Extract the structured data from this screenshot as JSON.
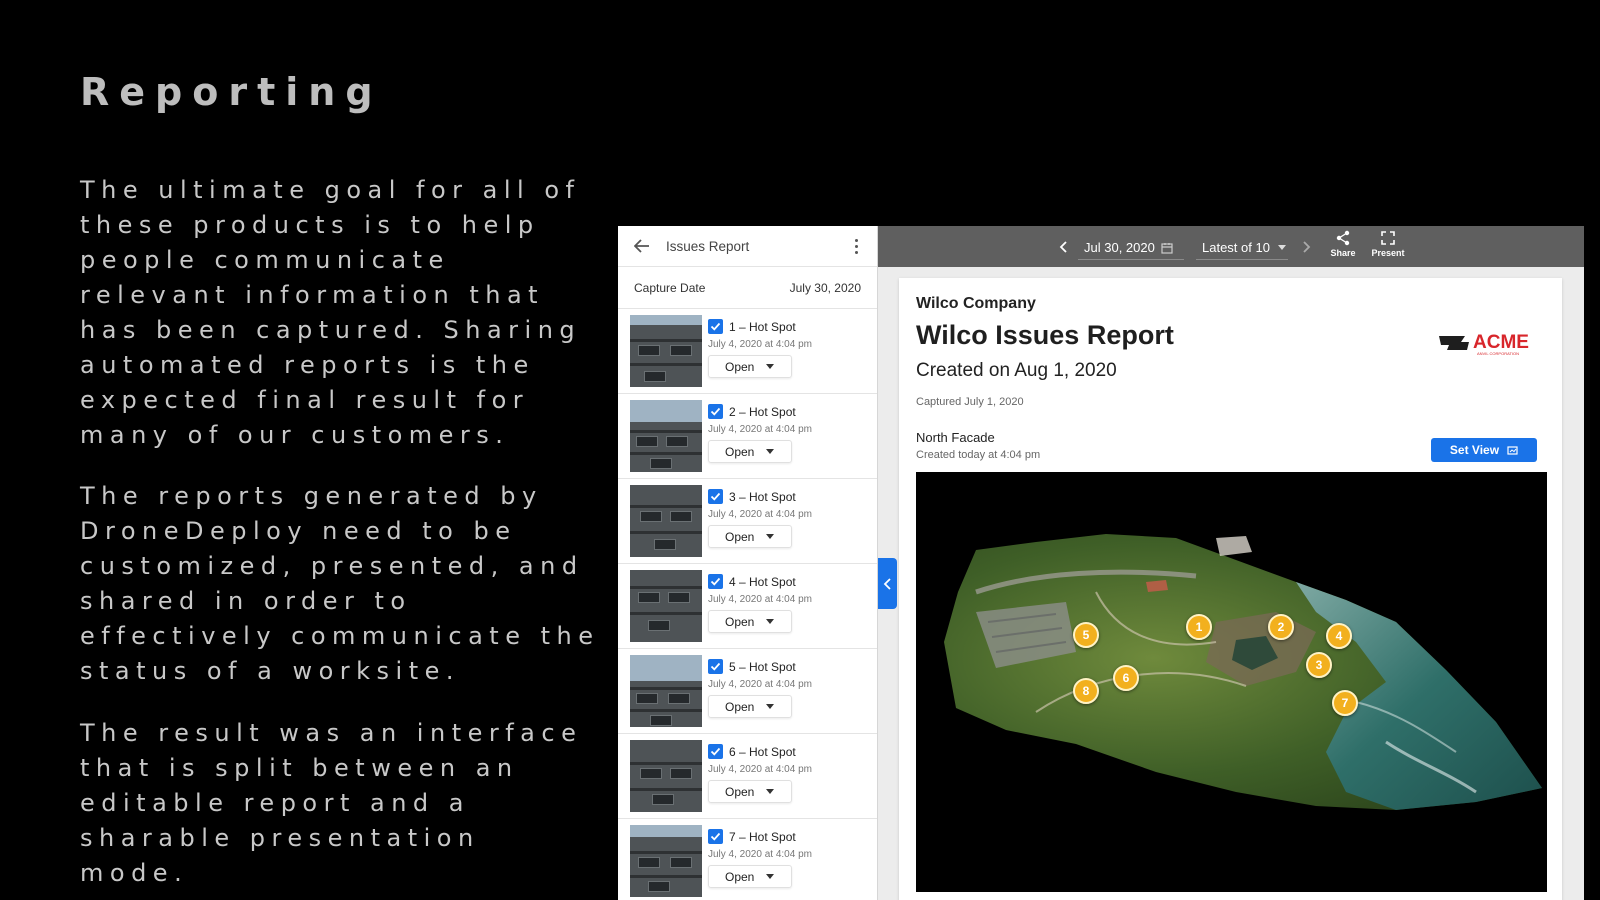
{
  "slide": {
    "title": "Reporting",
    "paragraphs": [
      "The ultimate goal for all of these products is to help people communicate relevant information that has been captured. Sharing automated reports is the expected final result for many of our customers.",
      "The reports generated by DroneDeploy need to be customized, presented, and shared in order to effectively communicate the status of a worksite.",
      "The result was an interface that is split between an editable report and a sharable presentation mode."
    ]
  },
  "sidebar": {
    "title": "Issues Report",
    "capture_label": "Capture Date",
    "capture_value": "July 30, 2020",
    "issues": [
      {
        "name": "1 – Hot Spot",
        "date": "July 4, 2020 at 4:04 pm",
        "status": "Open"
      },
      {
        "name": "2 – Hot Spot",
        "date": "July 4, 2020 at 4:04 pm",
        "status": "Open"
      },
      {
        "name": "3 – Hot Spot",
        "date": "July 4, 2020 at 4:04 pm",
        "status": "Open"
      },
      {
        "name": "4 – Hot Spot",
        "date": "July 4, 2020 at 4:04 pm",
        "status": "Open"
      },
      {
        "name": "5 – Hot Spot",
        "date": "July 4, 2020 at 4:04 pm",
        "status": "Open"
      },
      {
        "name": "6 – Hot Spot",
        "date": "July 4, 2020 at 4:04 pm",
        "status": "Open"
      },
      {
        "name": "7 – Hot Spot",
        "date": "July 4, 2020 at 4:04 pm",
        "status": "Open"
      }
    ]
  },
  "toolbar": {
    "date": "Jul 30, 2020",
    "version": "Latest of 10",
    "share_label": "Share",
    "present_label": "Present"
  },
  "report": {
    "company": "Wilco Company",
    "title": "Wilco Issues Report",
    "created": "Created on Aug 1, 2020",
    "captured": "Captured July 1, 2020",
    "logo_text": "ACME",
    "logo_subtext": "ANVIL CORPORATION",
    "view_name": "North Facade",
    "view_created": "Created today at 4:04 pm",
    "set_view_label": "Set View",
    "markers": [
      "1",
      "2",
      "3",
      "4",
      "5",
      "6",
      "7",
      "8"
    ]
  },
  "colors": {
    "accent": "#1a73e8",
    "marker": "#f2b01e",
    "toolbar": "#5f5f5f"
  }
}
